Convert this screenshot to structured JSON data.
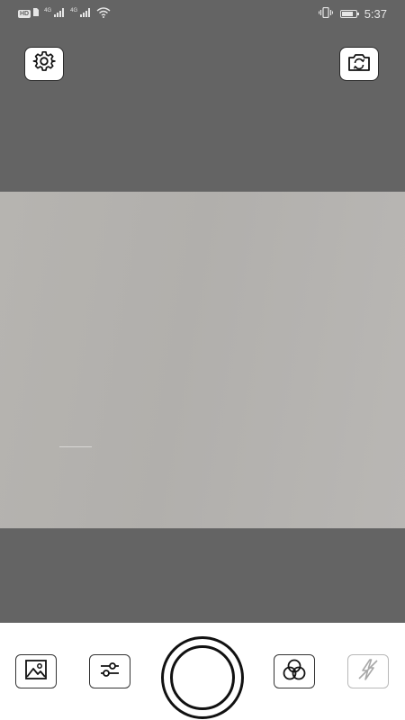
{
  "status_bar": {
    "hd_label": "HD",
    "net_label_1": "4G",
    "net_label_2": "4G",
    "time": "5:37",
    "battery_level": 0.85,
    "icons": [
      "sim-icon",
      "signal-icon",
      "signal-icon",
      "wifi-icon",
      "vibrate-icon",
      "battery-icon"
    ]
  },
  "top_controls": {
    "settings_icon": "gear-icon",
    "switch_camera_icon": "camera-switch-icon"
  },
  "bottom_controls": {
    "gallery_icon": "image-icon",
    "adjust_icon": "sliders-icon",
    "shutter_icon": "shutter-button",
    "filter_icon": "color-circles-icon",
    "flash_icon": "flash-off-icon"
  },
  "colors": {
    "background": "#646464",
    "preview": "#b3b1ae",
    "toolbar": "#ffffff",
    "icon": "#1a1a1a"
  }
}
